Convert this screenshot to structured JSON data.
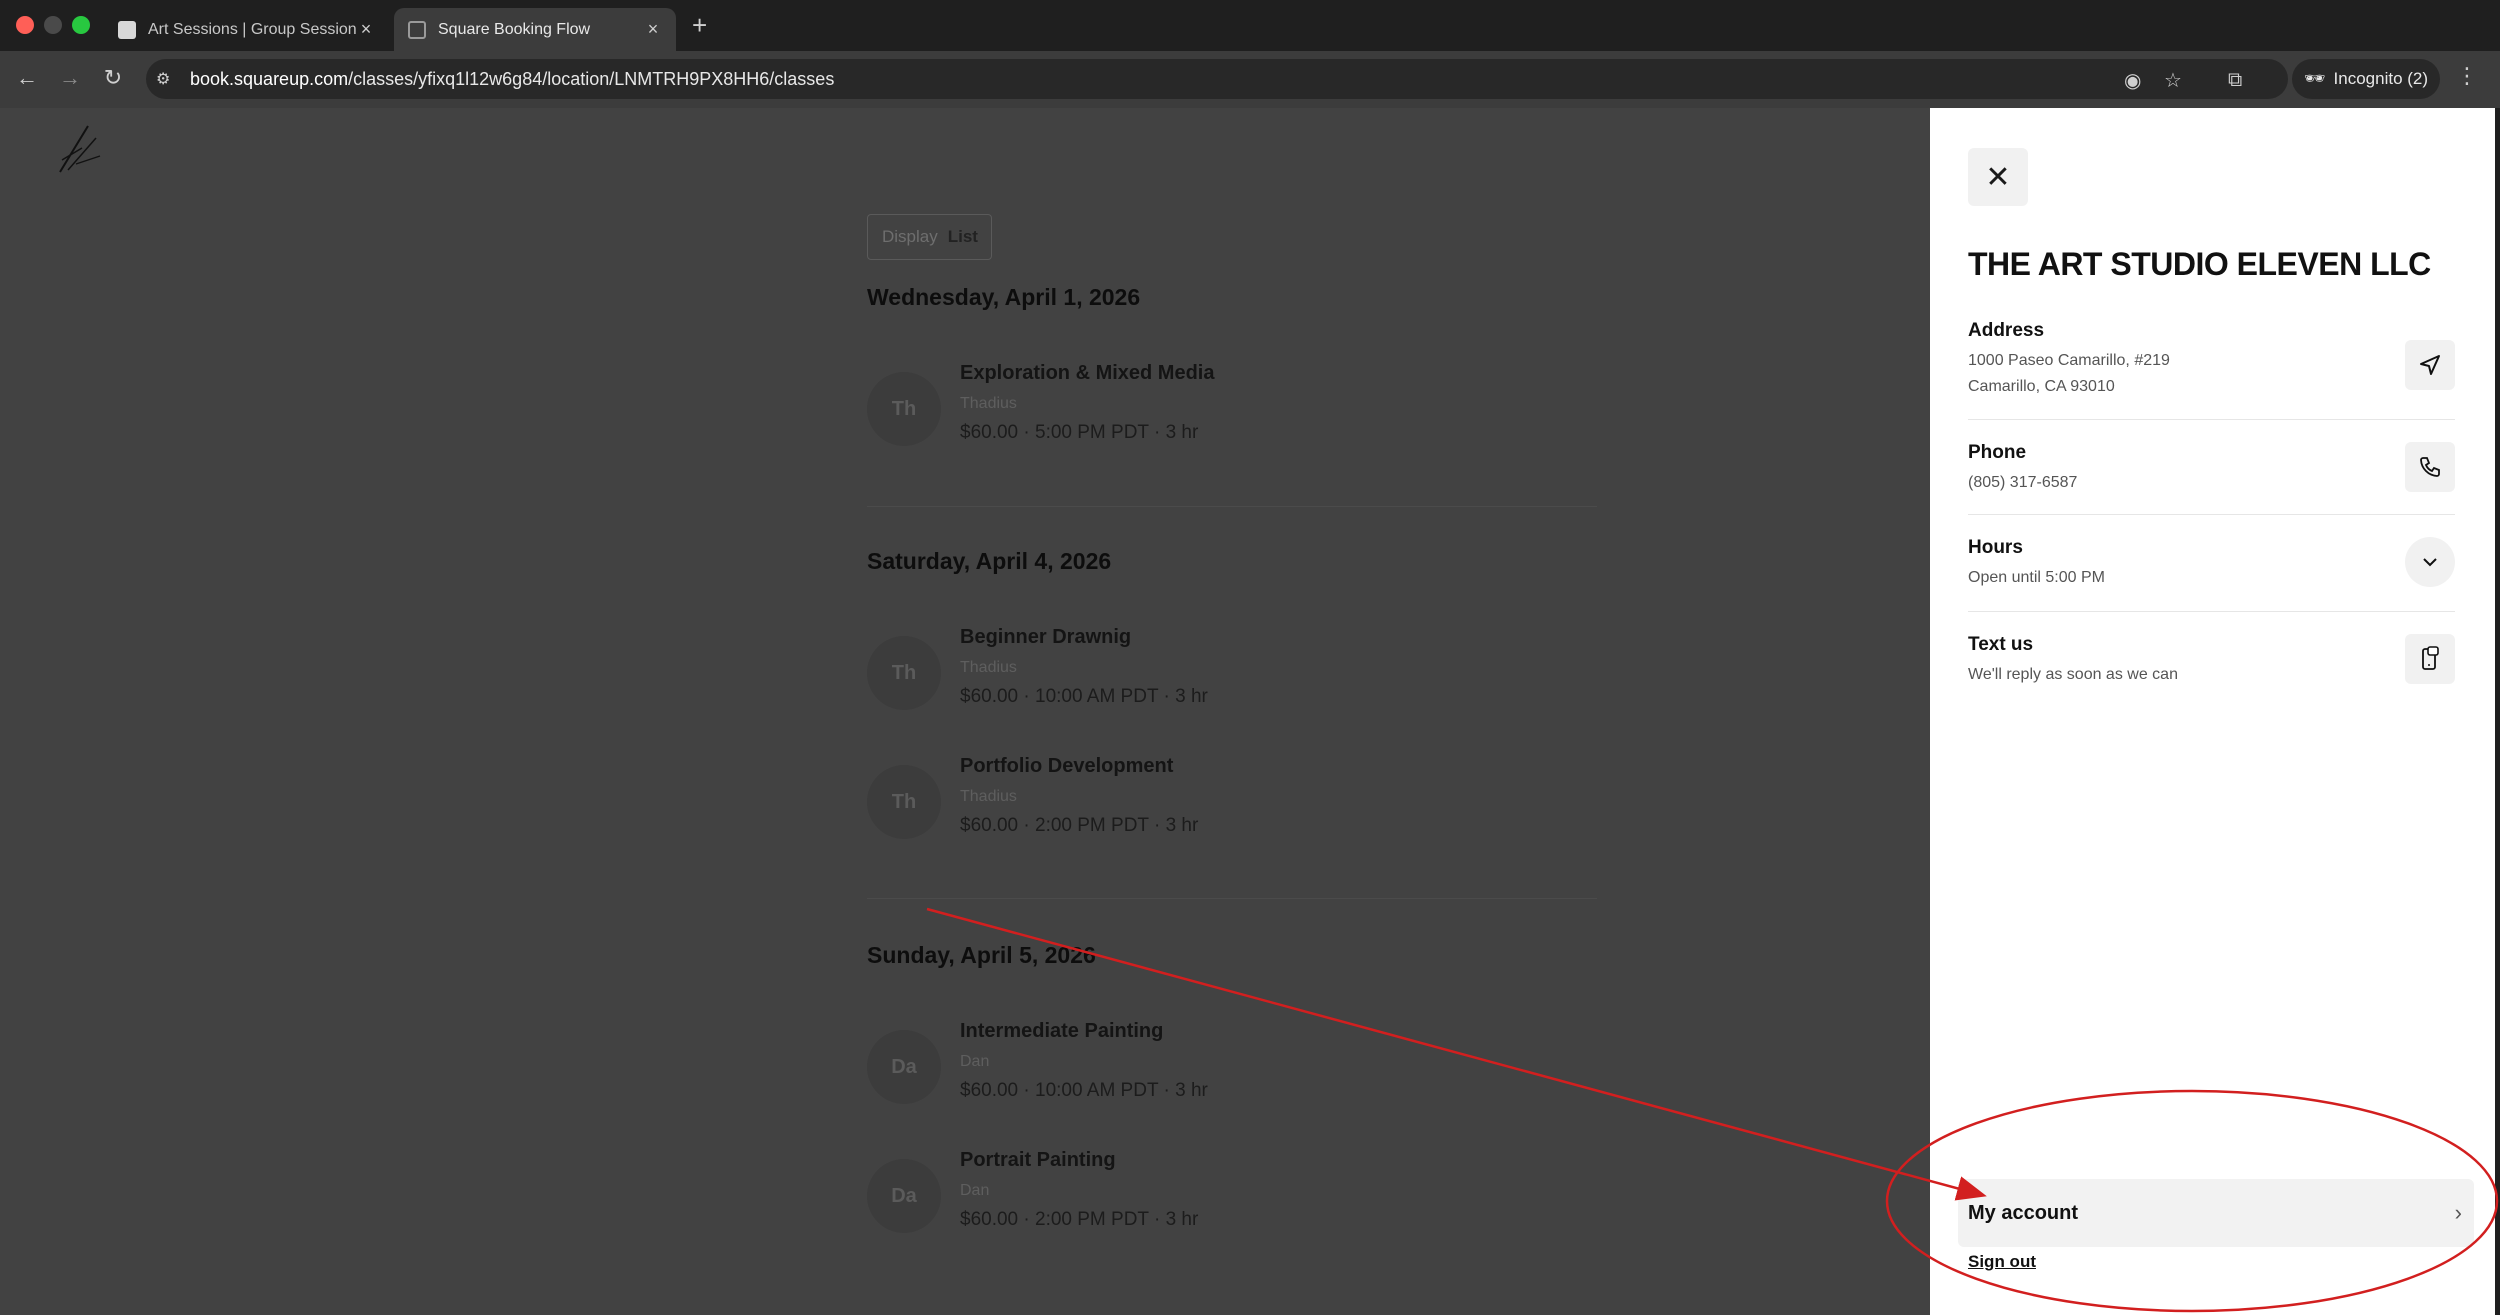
{
  "browser": {
    "tabs": [
      {
        "title": "Art Sessions | Group Sessions",
        "active": false
      },
      {
        "title": "Square Booking Flow",
        "active": true
      }
    ],
    "url_host": "book.squareup.com",
    "url_path": "/classes/yfixq1l12w6g84/location/LNMTRH9PX8HH6/classes",
    "incognito_label": "Incognito (2)"
  },
  "toggle": {
    "label": "Display",
    "value": "List"
  },
  "days": [
    {
      "date": "Wednesday, April 1, 2026",
      "classes": [
        {
          "initials": "Th",
          "name": "Exploration & Mixed Media",
          "instructor": "Thadius",
          "meta": "$60.00 · 5:00 PM PDT · 3 hr"
        }
      ]
    },
    {
      "date": "Saturday, April 4, 2026",
      "classes": [
        {
          "initials": "Th",
          "name": "Beginner Drawnig",
          "instructor": "Thadius",
          "meta": "$60.00 · 10:00 AM PDT · 3 hr"
        },
        {
          "initials": "Th",
          "name": "Portfolio Development",
          "instructor": "Thadius",
          "meta": "$60.00 · 2:00 PM PDT · 3 hr"
        }
      ]
    },
    {
      "date": "Sunday, April 5, 2026",
      "classes": [
        {
          "initials": "Da",
          "name": "Intermediate Painting",
          "instructor": "Dan",
          "meta": "$60.00 · 10:00 AM PDT · 3 hr"
        },
        {
          "initials": "Da",
          "name": "Portrait Painting",
          "instructor": "Dan",
          "meta": "$60.00 · 2:00 PM PDT · 3 hr"
        }
      ]
    }
  ],
  "drawer": {
    "business_name": "THE ART STUDIO ELEVEN LLC",
    "address": {
      "label": "Address",
      "line1": "1000 Paseo Camarillo, #219",
      "line2": "Camarillo, CA 93010"
    },
    "phone": {
      "label": "Phone",
      "value": "(805) 317-6587"
    },
    "hours": {
      "label": "Hours",
      "value": "Open until 5:00 PM"
    },
    "text_us": {
      "label": "Text us",
      "value": "We'll reply as soon as we can"
    },
    "my_account": "My account",
    "sign_out": "Sign out"
  },
  "colors": {
    "annotation": "#d21f1f",
    "overlay": "#424242",
    "drawer_bg": "#ffffff"
  }
}
